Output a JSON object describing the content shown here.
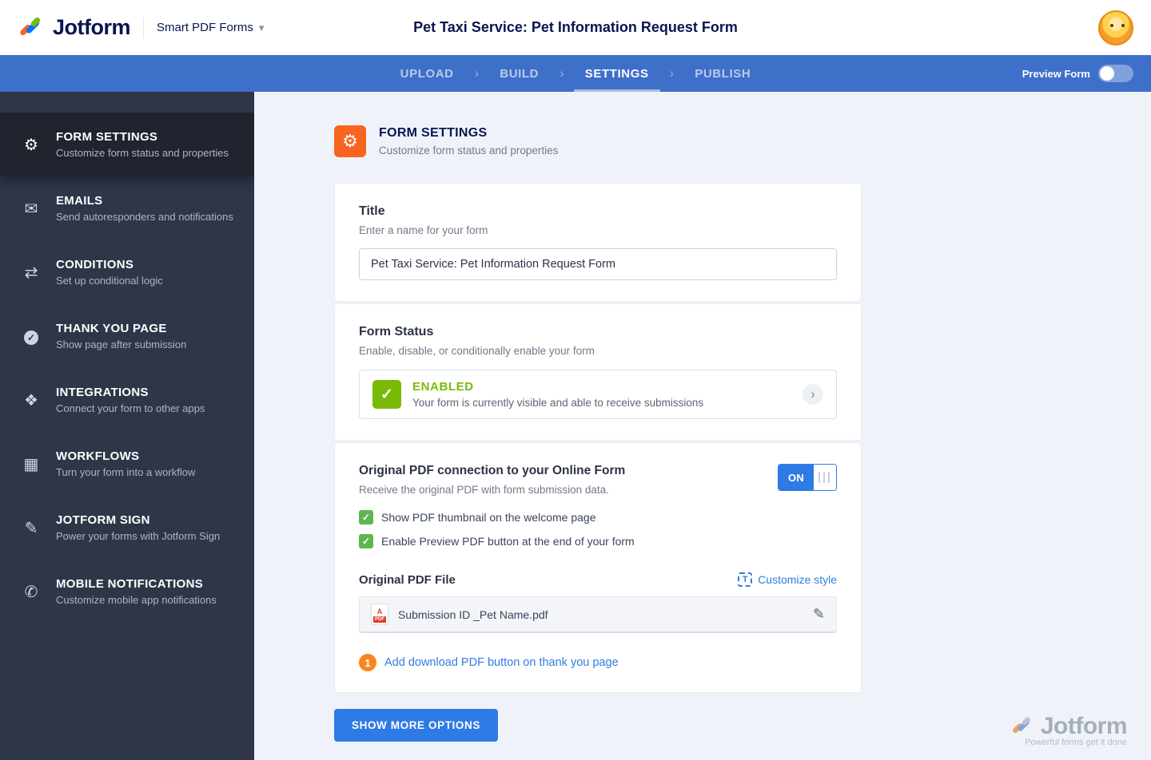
{
  "colors": {
    "navbar_blue": "#3e6fc9",
    "sidebar_navy": "#2e3648",
    "accent_orange": "#f7641f",
    "success_green": "#78bb07",
    "link_blue": "#2f7de1",
    "button_blue": "#2e7be5",
    "brand_navy": "#0a1551"
  },
  "icons": {
    "gear": "⚙",
    "mail": "✉",
    "branch": "⇄",
    "check": "✓",
    "puzzle": "❖",
    "grid": "▦",
    "pen": "✎",
    "phone": "✆",
    "chevron_right": "›",
    "chevron_down": "▾",
    "pencil": "✎",
    "letter_t": "T",
    "pdf_label": "PDF",
    "pdf_mark": "A"
  },
  "header": {
    "brand": "Jotform",
    "product": "Smart PDF Forms",
    "title": "Pet Taxi Service: Pet Information Request Form"
  },
  "navbar": {
    "tabs": [
      {
        "label": "UPLOAD"
      },
      {
        "label": "BUILD"
      },
      {
        "label": "SETTINGS"
      },
      {
        "label": "PUBLISH"
      }
    ],
    "active_tab": "SETTINGS",
    "preview_label": "Preview Form"
  },
  "sidebar": {
    "items": [
      {
        "title": "FORM SETTINGS",
        "desc": "Customize form status and properties"
      },
      {
        "title": "EMAILS",
        "desc": "Send autoresponders and notifications"
      },
      {
        "title": "CONDITIONS",
        "desc": "Set up conditional logic"
      },
      {
        "title": "THANK YOU PAGE",
        "desc": "Show page after submission"
      },
      {
        "title": "INTEGRATIONS",
        "desc": "Connect your form to other apps"
      },
      {
        "title": "WORKFLOWS",
        "desc": "Turn your form into a workflow"
      },
      {
        "title": "JOTFORM SIGN",
        "desc": "Power your forms with Jotform Sign"
      },
      {
        "title": "MOBILE NOTIFICATIONS",
        "desc": "Customize mobile app notifications"
      }
    ]
  },
  "main": {
    "section_header": {
      "title": "FORM SETTINGS",
      "subtitle": "Customize form status and properties"
    },
    "title_card": {
      "label": "Title",
      "hint": "Enter a name for your form",
      "value": "Pet Taxi Service: Pet Information Request Form"
    },
    "status_card": {
      "label": "Form Status",
      "hint": "Enable, disable, or conditionally enable your form",
      "status": "ENABLED",
      "status_desc": "Your form is currently visible and able to receive submissions"
    },
    "pdf_card": {
      "label": "Original PDF connection to your Online Form",
      "hint": "Receive the original PDF with form submission data.",
      "toggle_state": "ON",
      "check1": "Show PDF thumbnail on the welcome page",
      "check2": "Enable Preview PDF button at the end of your form",
      "file_label": "Original PDF File",
      "customize_style": "Customize style",
      "file_name": "Submission ID _Pet Name.pdf",
      "badge": "1",
      "add_link": "Add download PDF button on thank you page"
    },
    "show_more": "SHOW MORE OPTIONS"
  },
  "watermark": {
    "brand": "Jotform",
    "tagline": "Powerful forms get it done"
  }
}
